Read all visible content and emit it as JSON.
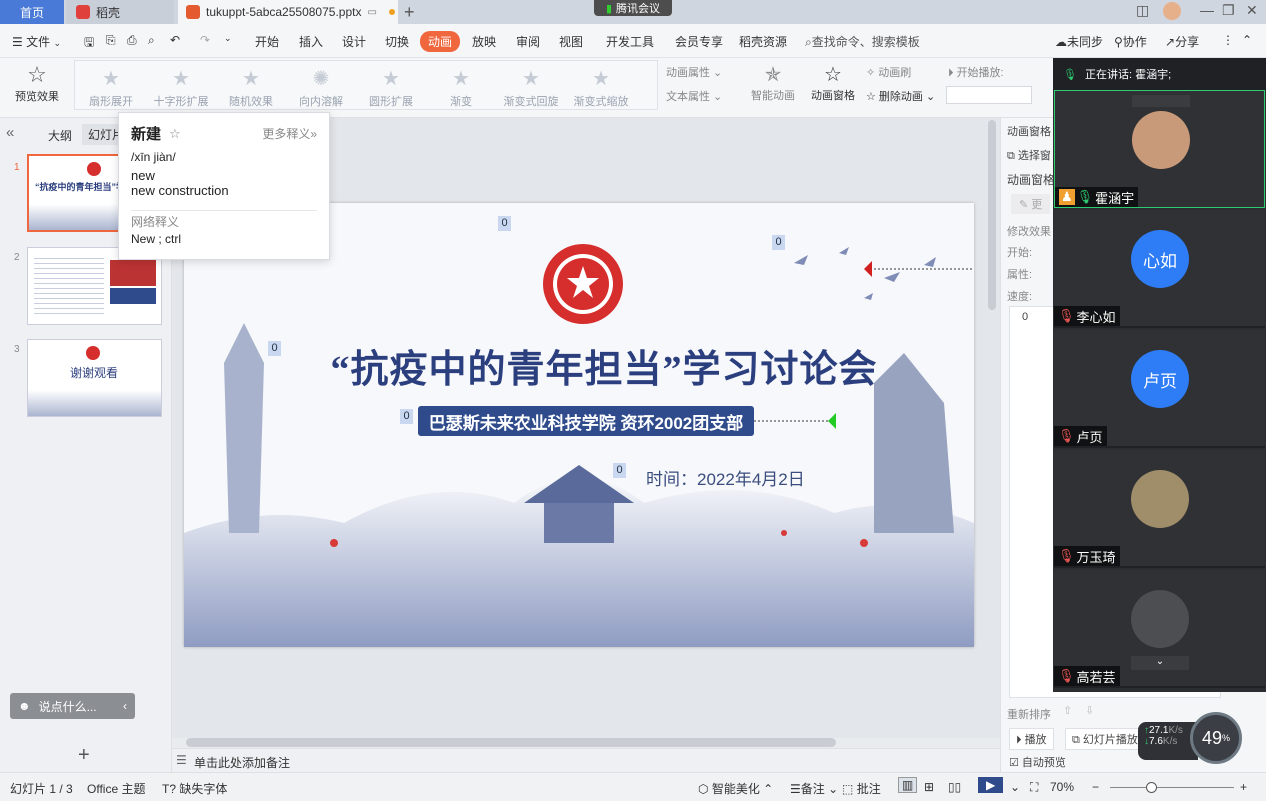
{
  "tabs": {
    "home": "首页",
    "docer": "稻壳",
    "file": "tukuppt-5abca25508075.pptx",
    "meeting": "腾讯会议"
  },
  "menubar": {
    "file_menu": "文件",
    "items": [
      "开始",
      "插入",
      "设计",
      "切换",
      "动画",
      "放映",
      "审阅",
      "视图",
      "开发工具",
      "会员专享",
      "稻壳资源"
    ],
    "active": "动画",
    "search": "查找命令、搜索模板",
    "unsync": "未同步",
    "collab": "协作",
    "share": "分享"
  },
  "ribbon": {
    "preview": "预览效果",
    "effects": [
      "扇形展开",
      "十字形扩展",
      "随机效果",
      "向内溶解",
      "圆形扩展",
      "渐变",
      "渐变式回旋",
      "渐变式缩放"
    ],
    "anim_prop": "动画属性",
    "text_prop": "文本属性",
    "smart_anim": "智能动画",
    "anim_window": "动画窗格",
    "anim_brush": "动画刷",
    "delete_anim": "删除动画",
    "start_play": "开始播放:"
  },
  "leftpane": {
    "outline_tab": "大纲",
    "slides_tab": "幻灯片",
    "thumb1_title": "“抗疫中的青年担当”学",
    "thumb3_title": "谢谢观看",
    "add": "+",
    "slide_numbers": [
      "1",
      "2",
      "3"
    ]
  },
  "dictionary": {
    "word": "新建",
    "more": "更多释义»",
    "pinyin": "/xīn jiàn/",
    "meaning1": "new",
    "meaning2": "new construction",
    "web_label": "网络释义",
    "web_meaning": "New ; ctrl"
  },
  "slide": {
    "title": "“抗疫中的青年担当”学习讨论会",
    "subtitle": "巴瑟斯未来农业科技学院   资环2002团支部",
    "time": "时间：2022年4月2日",
    "markers": [
      "0",
      "0",
      "0",
      "0",
      "0"
    ]
  },
  "notes": {
    "placeholder": "单击此处添加备注"
  },
  "chat": {
    "placeholder": "说点什么..."
  },
  "rightpane": {
    "title": "动画窗格",
    "select_pane": "选择窗",
    "anim_window2": "动画窗格",
    "change": "更",
    "modify": "修改效果",
    "start": "开始:",
    "property": "属性:",
    "speed": "速度:",
    "reorder": "重新排序",
    "play": "播放",
    "slideshow": "幻灯片播放",
    "auto_preview": "自动预览",
    "list_num": "0"
  },
  "meeting": {
    "speaking": "正在讲话: 霍涵宇;",
    "participants": [
      {
        "name": "霍涵宇",
        "avatar": ""
      },
      {
        "name": "李心如",
        "avatar": "心如"
      },
      {
        "name": "卢页",
        "avatar": "卢页"
      },
      {
        "name": "万玉琦",
        "avatar": ""
      },
      {
        "name": "高若芸",
        "avatar": ""
      }
    ],
    "speed_up": "27.1",
    "speed_down": "7.6",
    "speed_unit": "K/s",
    "cpu": "49",
    "cpu_unit": "%"
  },
  "statusbar": {
    "slide_info": "幻灯片 1 / 3",
    "theme": "Office 主题",
    "missing_font": "缺失字体",
    "smart_beautify": "智能美化",
    "notes": "备注",
    "comment": "批注",
    "zoom": "70%"
  },
  "colors": {
    "accent": "#f0663d",
    "slide_blue": "#2f4b8c",
    "meeting_bg": "#2b2d30",
    "avatar_blue": "#2e7df6"
  }
}
